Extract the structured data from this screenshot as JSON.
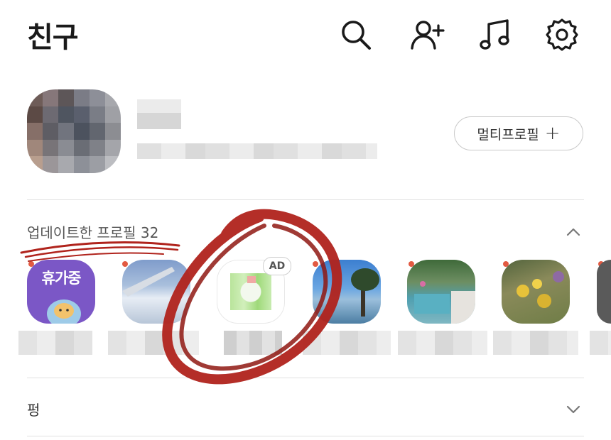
{
  "header": {
    "title": "친구",
    "icons": [
      "search-icon",
      "add-friend-icon",
      "music-icon",
      "settings-icon"
    ]
  },
  "my_profile": {
    "multi_profile_label": "멀티프로필",
    "multi_profile_plus": "+"
  },
  "updated_profiles": {
    "label": "업데이트한 프로필 32",
    "items": [
      {
        "kind": "vacation",
        "badge_text": "휴가중",
        "has_new_dot": true
      },
      {
        "kind": "photo-sky-clouds",
        "has_new_dot": true
      },
      {
        "kind": "ad",
        "ad_label": "AD",
        "has_new_dot": false
      },
      {
        "kind": "photo-tree-lake",
        "has_new_dot": true
      },
      {
        "kind": "photo-pool",
        "has_new_dot": true
      },
      {
        "kind": "photo-flowers",
        "has_new_dot": true
      },
      {
        "kind": "photo-partial",
        "has_new_dot": true
      }
    ]
  },
  "sections": [
    {
      "label": "펑"
    }
  ],
  "colors": {
    "new_dot": "#e25a42",
    "annotation_red": "#b0231c",
    "vacation_bg": "#7b57c6"
  }
}
